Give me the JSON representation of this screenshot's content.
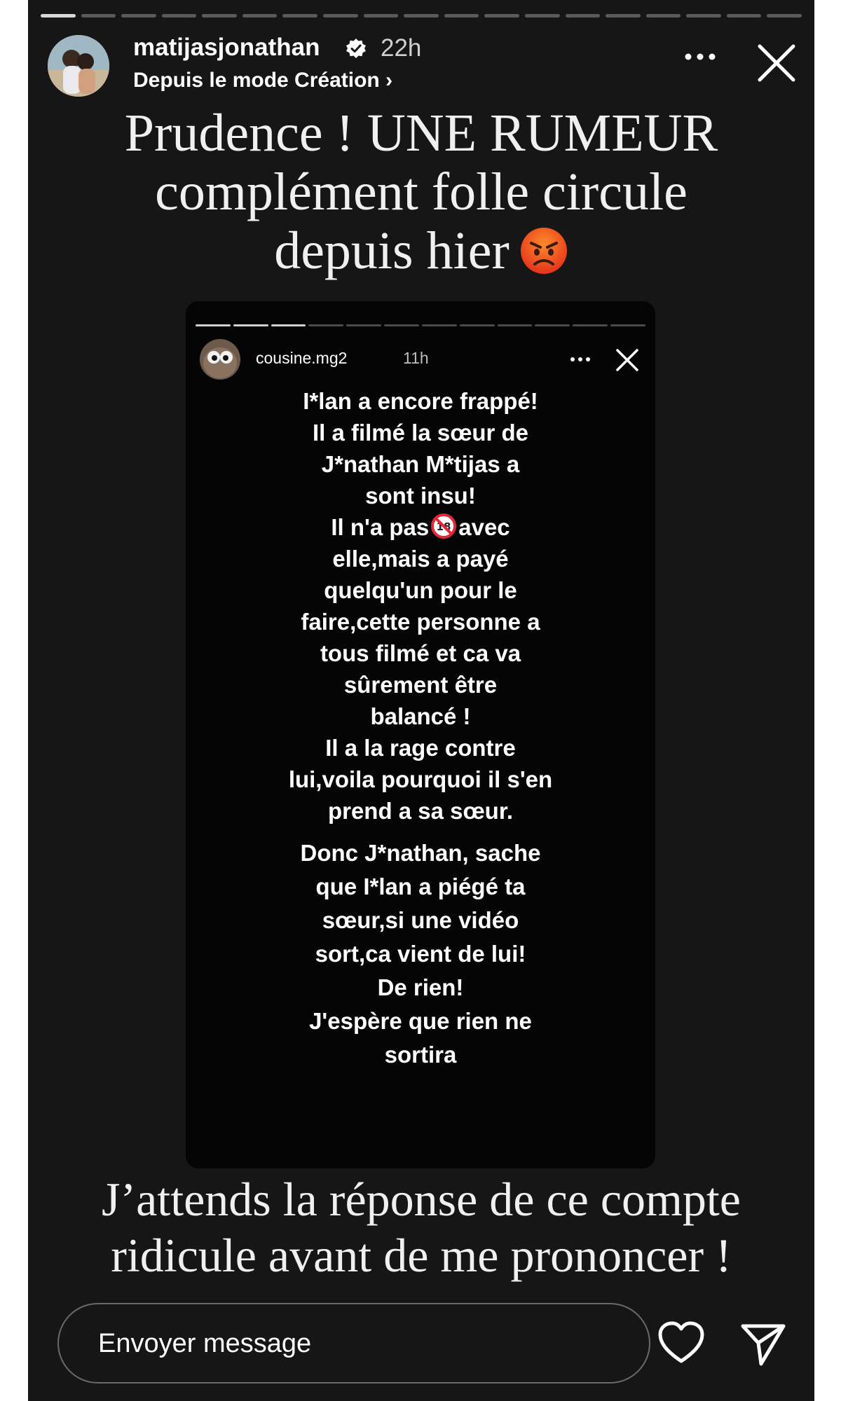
{
  "story": {
    "progress": {
      "segments": 19,
      "viewed": 1
    },
    "header": {
      "username": "matijasjonathan",
      "time": "22h",
      "subtitle": "Depuis le mode Création ›"
    },
    "headline": {
      "lines": [
        "Prudence ! UNE RUMEUR",
        "complément folle circule",
        "depuis hier"
      ],
      "emoji": "angry-face-emoji"
    },
    "embedded_story": {
      "progress": {
        "segments": 12,
        "viewed": 3
      },
      "username": "cousine.mg2",
      "time": "11h",
      "paragraphs": [
        [
          "I*lan a encore frappé!",
          "Il a filmé la sœur de",
          "J*nathan M*tijas a",
          "sont insu!",
          "Il n'a pas",
          "avec",
          "elle,mais a payé",
          "quelqu'un pour le",
          "faire,cette personne a",
          "tous filmé et ca va",
          "sûrement être",
          "balancé !",
          "Il a la rage contre",
          "lui,voila pourquoi il s'en",
          "prend a sa sœur."
        ],
        [
          "Donc J*nathan, sache",
          "que I*lan a piégé ta",
          "sœur,si une vidéo",
          "sort,ca vient de lui!",
          "De rien!",
          "J'espère que rien ne",
          "sortira"
        ]
      ]
    },
    "footer": {
      "lines": [
        "J’attends la réponse de ce compte",
        "ridicule avant de me prononcer !"
      ]
    },
    "reply": {
      "placeholder": "Envoyer message"
    },
    "icons": {
      "more": "more-icon",
      "close": "close-icon",
      "verified": "verified-badge-icon",
      "like": "heart-icon",
      "send": "send-icon",
      "no_under_18": "no-under-18-emoji"
    },
    "colors": {
      "background": "#161616",
      "embed_background": "#050505",
      "text": "#ffffff",
      "verified": "#ffffff"
    }
  }
}
